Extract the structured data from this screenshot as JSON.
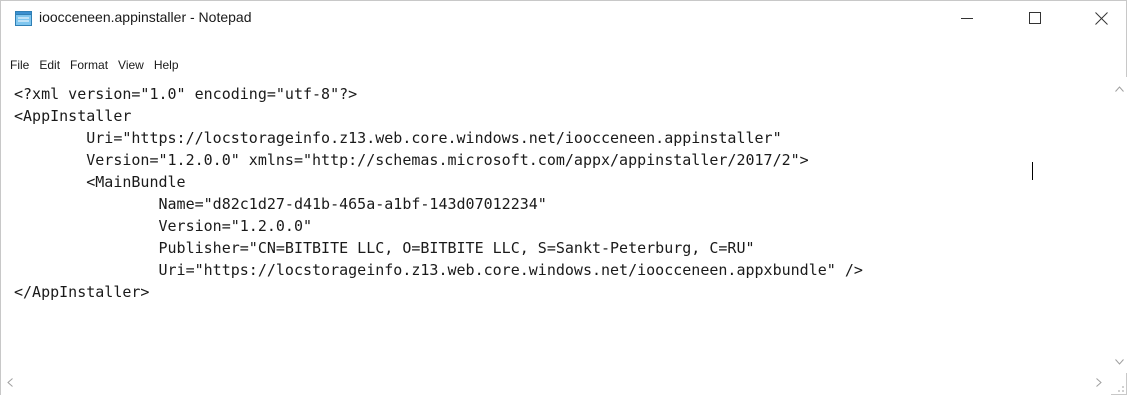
{
  "window": {
    "title": "ioocceneen.appinstaller - Notepad",
    "app_icon": "notepad-icon",
    "controls": {
      "minimize": "minimize-icon",
      "maximize": "maximize-icon",
      "close": "close-icon"
    }
  },
  "menu": {
    "items": [
      {
        "label": "File"
      },
      {
        "label": "Edit"
      },
      {
        "label": "Format"
      },
      {
        "label": "View"
      },
      {
        "label": "Help"
      }
    ]
  },
  "editor": {
    "content": "<?xml version=\"1.0\" encoding=\"utf-8\"?>\n<AppInstaller\n        Uri=\"https://locstorageinfo.z13.web.core.windows.net/ioocceneen.appinstaller\"\n        Version=\"1.2.0.0\" xmlns=\"http://schemas.microsoft.com/appx/appinstaller/2017/2\">\n        <MainBundle\n                Name=\"d82c1d27-d41b-465a-a1bf-143d07012234\"\n                Version=\"1.2.0.0\"\n                Publisher=\"CN=BITBITE LLC, O=BITBITE LLC, S=Sankt-Peterburg, C=RU\"\n                Uri=\"https://locstorageinfo.z13.web.core.windows.net/ioocceneen.appxbundle\" />\n</AppInstaller>"
  },
  "scrollbars": {
    "up": "chevron-up-icon",
    "down": "chevron-down-icon",
    "left": "chevron-left-icon",
    "right": "chevron-right-icon"
  }
}
